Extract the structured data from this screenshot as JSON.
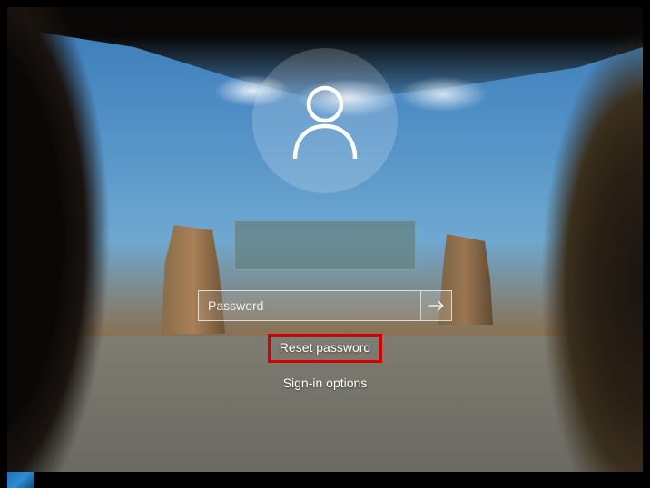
{
  "login": {
    "username": "",
    "password_placeholder": "Password",
    "password_value": "",
    "reset_password_label": "Reset password",
    "signin_options_label": "Sign-in options"
  },
  "highlight": {
    "color": "#d40000",
    "target": "reset-password-link"
  }
}
